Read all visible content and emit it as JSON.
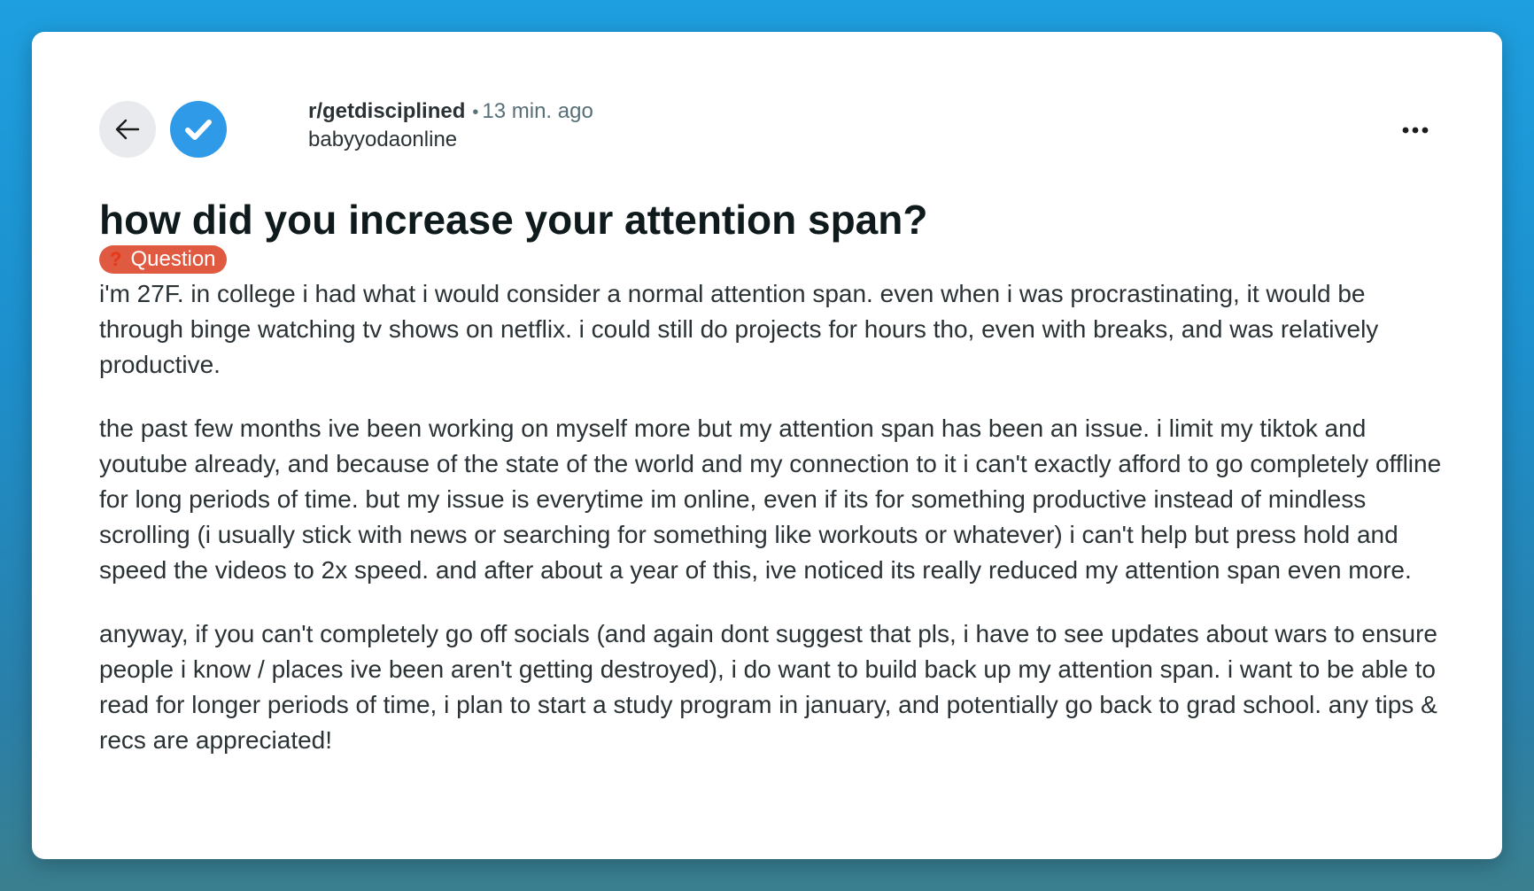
{
  "post": {
    "subreddit": "r/getdisciplined",
    "separator": "•",
    "time_ago": "13 min. ago",
    "author": "babyyodaonline",
    "title": "how did you increase your attention span?",
    "flair": {
      "icon": "question-mark-icon",
      "glyph": "❓",
      "label": "Question",
      "color": "#e05a41"
    },
    "paragraphs": [
      "i'm 27F. in college i had what i would consider a normal attention span. even when i was procrastinating, it would be through binge watching tv shows on netflix. i could still do projects for hours tho, even with breaks, and was relatively productive.",
      "the past few months ive been working on myself more but my attention span has been an issue. i limit my tiktok and youtube already, and because of the state of the world and my connection to it i can't exactly afford to go completely offline for long periods of time. but my issue is everytime im online, even if its for something productive instead of mindless scrolling (i usually stick with news or searching for something like workouts or whatever) i can't help but press hold and speed the videos to 2x speed. and after about a year of this, ive noticed its really reduced my attention span even more.",
      "anyway, if you can't completely go off socials (and again dont suggest that pls, i have to see updates about wars to ensure people i know / places ive been aren't getting destroyed), i do want to build back up my attention span. i want to be able to read for longer periods of time, i plan to start a study program in january, and potentially go back to grad school. any tips & recs are appreciated!"
    ]
  },
  "icons": {
    "back": "back-arrow-icon",
    "avatar": "verified-check-icon",
    "more": "more-options-icon"
  },
  "colors": {
    "background_top": "#1e9fe0",
    "card": "#ffffff",
    "avatar": "#2f9ae8",
    "flair": "#e05a41",
    "text": "#2a3236"
  }
}
